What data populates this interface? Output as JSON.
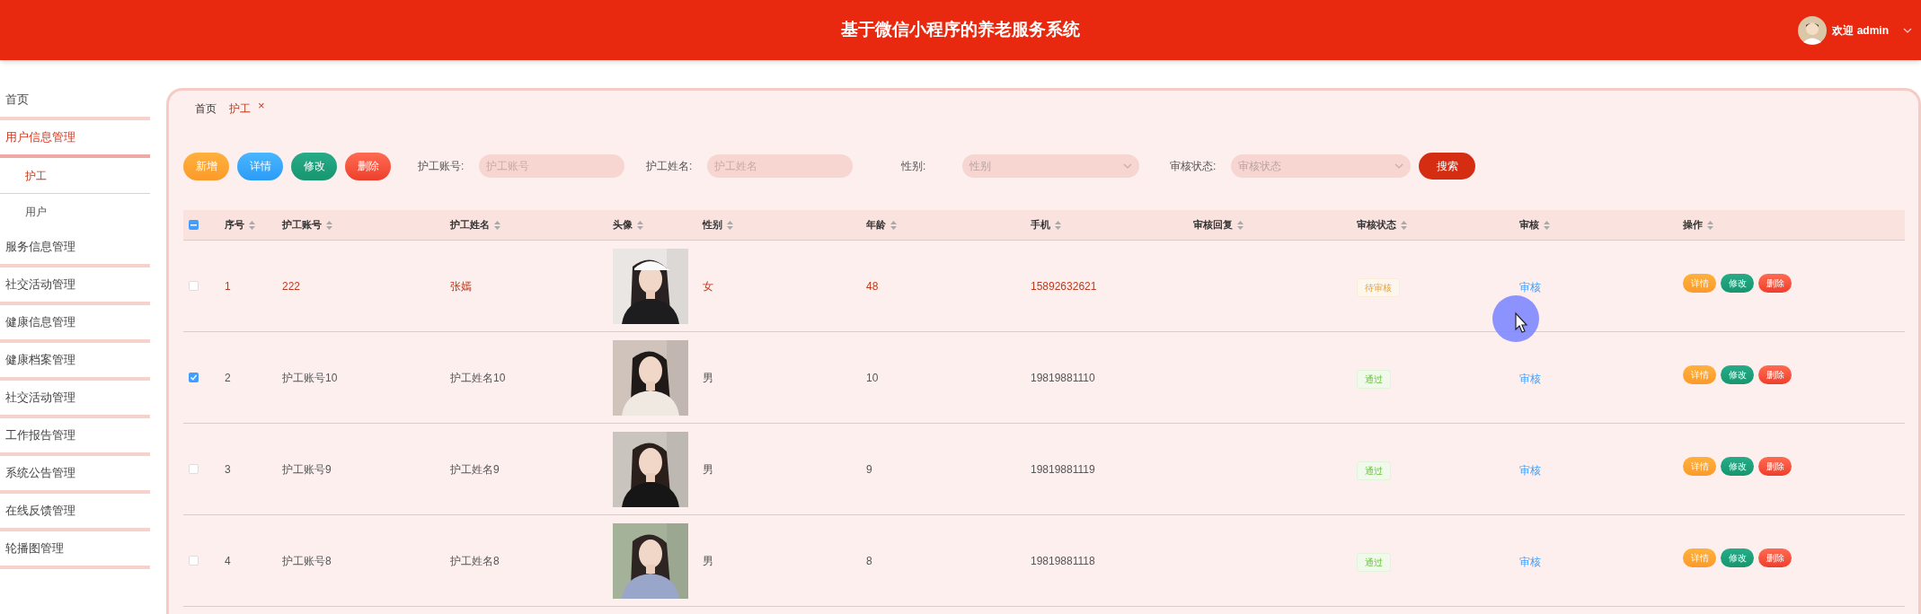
{
  "header": {
    "title": "基于微信小程序的养老服务系统",
    "user": {
      "greeting": "欢迎 admin"
    }
  },
  "sidebar": {
    "items": [
      {
        "label": "首页",
        "selected": false
      },
      {
        "label": "用户信息管理",
        "selected": true,
        "children": [
          {
            "label": "护工",
            "selected": true
          },
          {
            "label": "用户",
            "selected": false
          }
        ]
      },
      {
        "label": "服务信息管理",
        "selected": false
      },
      {
        "label": "社交活动管理",
        "selected": false
      },
      {
        "label": "健康信息管理",
        "selected": false
      },
      {
        "label": "健康档案管理",
        "selected": false
      },
      {
        "label": "社交活动管理",
        "selected": false
      },
      {
        "label": "工作报告管理",
        "selected": false
      },
      {
        "label": "系统公告管理",
        "selected": false
      },
      {
        "label": "在线反馈管理",
        "selected": false
      },
      {
        "label": "轮播图管理",
        "selected": false
      }
    ]
  },
  "tabs": [
    {
      "label": "首页",
      "selected": false
    },
    {
      "label": "护工",
      "selected": true,
      "close": "×"
    }
  ],
  "toolbar": {
    "buttons": [
      {
        "label": "新增",
        "kind": "add"
      },
      {
        "label": "详情",
        "kind": "detail"
      },
      {
        "label": "修改",
        "kind": "edit"
      },
      {
        "label": "删除",
        "kind": "delete"
      }
    ],
    "filters": [
      {
        "label": "护工账号:",
        "placeholder": "护工账号",
        "kind": "input"
      },
      {
        "label": "护工姓名:",
        "placeholder": "护工姓名",
        "kind": "input"
      },
      {
        "label": "性别:",
        "placeholder": "性别",
        "kind": "select"
      },
      {
        "label": "审核状态:",
        "placeholder": "审核状态",
        "kind": "select"
      }
    ],
    "search_button": "搜索"
  },
  "table": {
    "select_all_partial": true,
    "columns": [
      "序号",
      "护工账号",
      "护工姓名",
      "头像",
      "性别",
      "年龄",
      "手机",
      "审核回复",
      "审核状态",
      "审核",
      "操作"
    ],
    "rows": [
      {
        "selected": false,
        "highlighted": true,
        "index": "1",
        "account": "222",
        "name": "张嫣",
        "gender": "女",
        "age": "48",
        "phone": "15892632621",
        "status": "待审核",
        "approved": false,
        "review_link": "审核",
        "actions": [
          "详情",
          "修改",
          "删除"
        ]
      },
      {
        "selected": true,
        "highlighted": false,
        "index": "2",
        "account": "护工账号10",
        "name": "护工姓名10",
        "gender": "男",
        "age": "10",
        "phone": "19819881110",
        "status": "通过",
        "approved": true,
        "review_link": "审核",
        "actions": [
          "详情",
          "修改",
          "删除"
        ]
      },
      {
        "selected": false,
        "highlighted": false,
        "index": "3",
        "account": "护工账号9",
        "name": "护工姓名9",
        "gender": "男",
        "age": "9",
        "phone": "19819881119",
        "status": "通过",
        "approved": true,
        "review_link": "审核",
        "actions": [
          "详情",
          "修改",
          "删除"
        ]
      },
      {
        "selected": false,
        "highlighted": false,
        "index": "4",
        "account": "护工账号8",
        "name": "护工姓名8",
        "gender": "男",
        "age": "8",
        "phone": "19819881118",
        "status": "通过",
        "approved": true,
        "review_link": "审核",
        "actions": [
          "详情",
          "修改",
          "删除"
        ]
      }
    ]
  }
}
